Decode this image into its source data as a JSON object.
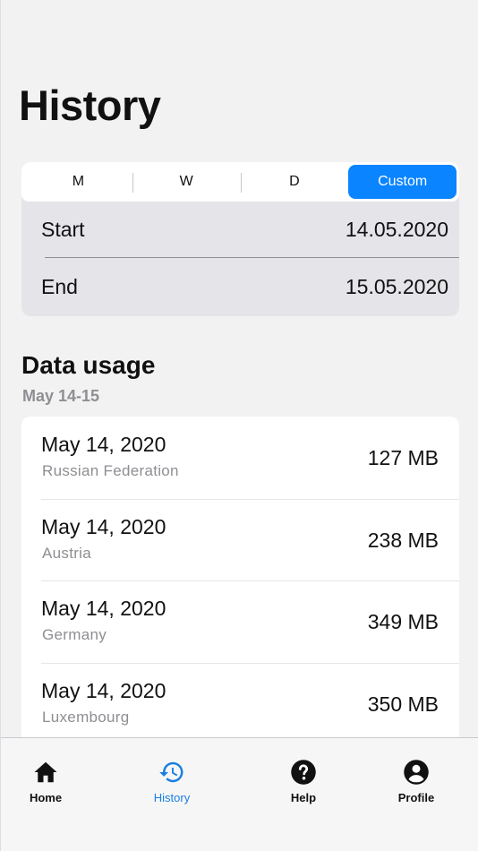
{
  "header": {
    "title": "History"
  },
  "filter": {
    "segments": [
      {
        "label": "M",
        "active": false
      },
      {
        "label": "W",
        "active": false
      },
      {
        "label": "D",
        "active": false
      },
      {
        "label": "Custom",
        "active": true
      }
    ],
    "start": {
      "label": "Start",
      "value": "14.05.2020"
    },
    "end": {
      "label": "End",
      "value": "15.05.2020"
    },
    "accent_color": "#0a84ff"
  },
  "data_usage": {
    "title": "Data usage",
    "subtitle": "May 14-15",
    "rows": [
      {
        "date": "May 14, 2020",
        "country": "Russian Federation",
        "amount": "127 MB"
      },
      {
        "date": "May 14, 2020",
        "country": "Austria",
        "amount": "238 MB"
      },
      {
        "date": "May 14, 2020",
        "country": "Germany",
        "amount": "349 MB"
      },
      {
        "date": "May 14, 2020",
        "country": "Luxembourg",
        "amount": "350 MB"
      }
    ]
  },
  "tabbar": {
    "items": [
      {
        "label": "Home",
        "icon": "home-icon",
        "active": false
      },
      {
        "label": "History",
        "icon": "history-icon",
        "active": true
      },
      {
        "label": "Help",
        "icon": "help-icon",
        "active": false
      },
      {
        "label": "Profile",
        "icon": "profile-icon",
        "active": false
      }
    ],
    "active_color": "#1a7fe0"
  }
}
